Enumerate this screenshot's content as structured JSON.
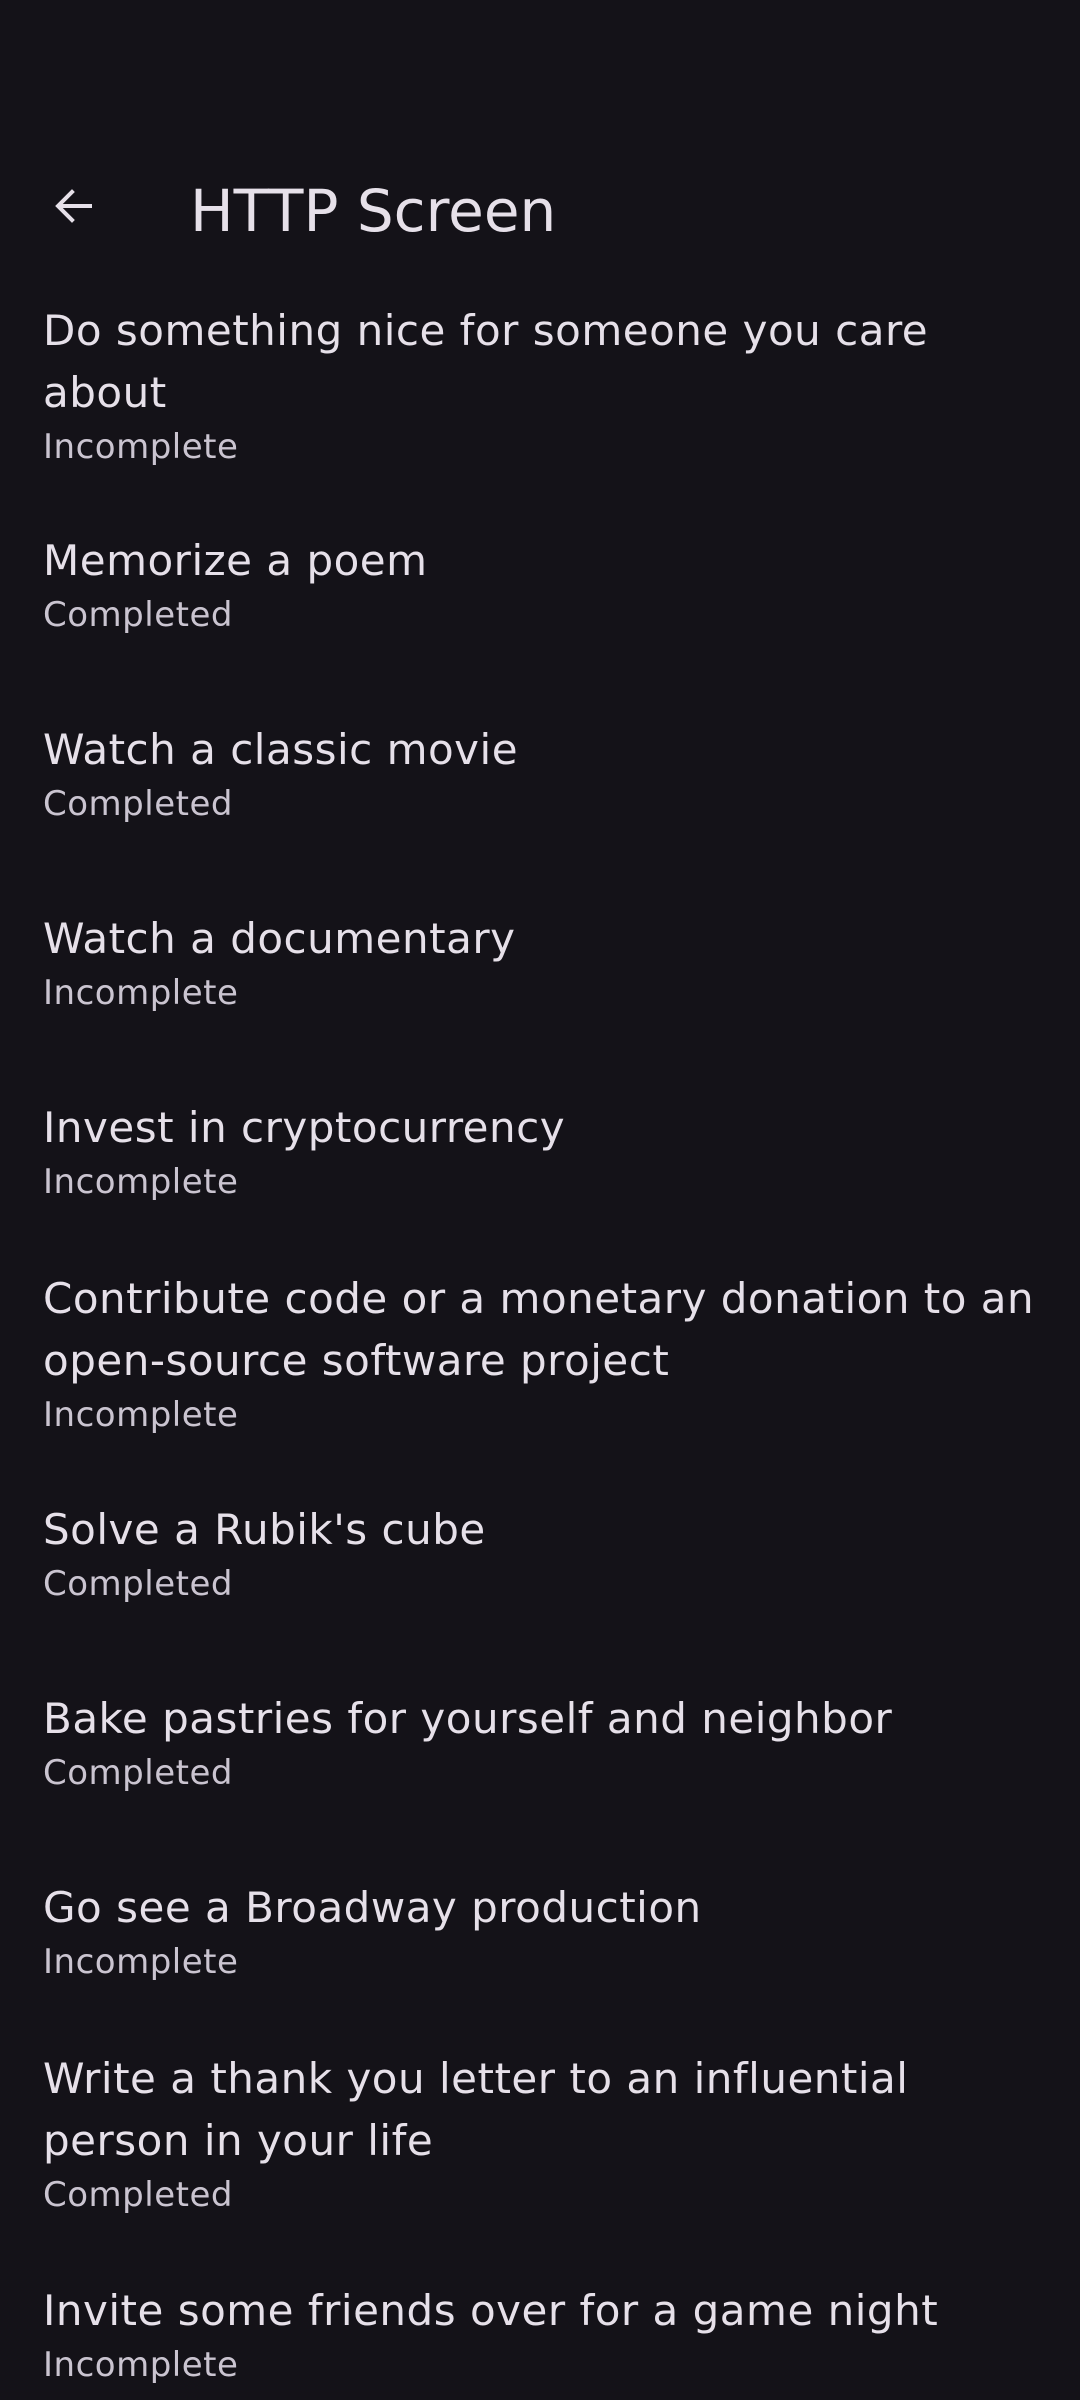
{
  "app_bar": {
    "title": "HTTP Screen",
    "back_icon": "arrow-back-icon"
  },
  "items": [
    {
      "title": "Do something nice for someone you care about",
      "status": "Incomplete"
    },
    {
      "title": "Memorize a poem",
      "status": "Completed"
    },
    {
      "title": "Watch a classic movie",
      "status": "Completed"
    },
    {
      "title": "Watch a documentary",
      "status": "Incomplete"
    },
    {
      "title": "Invest in cryptocurrency",
      "status": "Incomplete"
    },
    {
      "title": "Contribute code or a monetary donation to an open-source software project",
      "status": "Incomplete"
    },
    {
      "title": "Solve a Rubik's cube",
      "status": "Completed"
    },
    {
      "title": "Bake pastries for yourself and neighbor",
      "status": "Completed"
    },
    {
      "title": "Go see a Broadway production",
      "status": "Incomplete"
    },
    {
      "title": "Write a thank you letter to an influential person in your life",
      "status": "Completed"
    },
    {
      "title": "Invite some friends over for a game night",
      "status": "Incomplete"
    }
  ],
  "colors": {
    "background": "#141218",
    "on_surface": "#e6e0e9",
    "on_surface_variant": "#cac4d0"
  }
}
